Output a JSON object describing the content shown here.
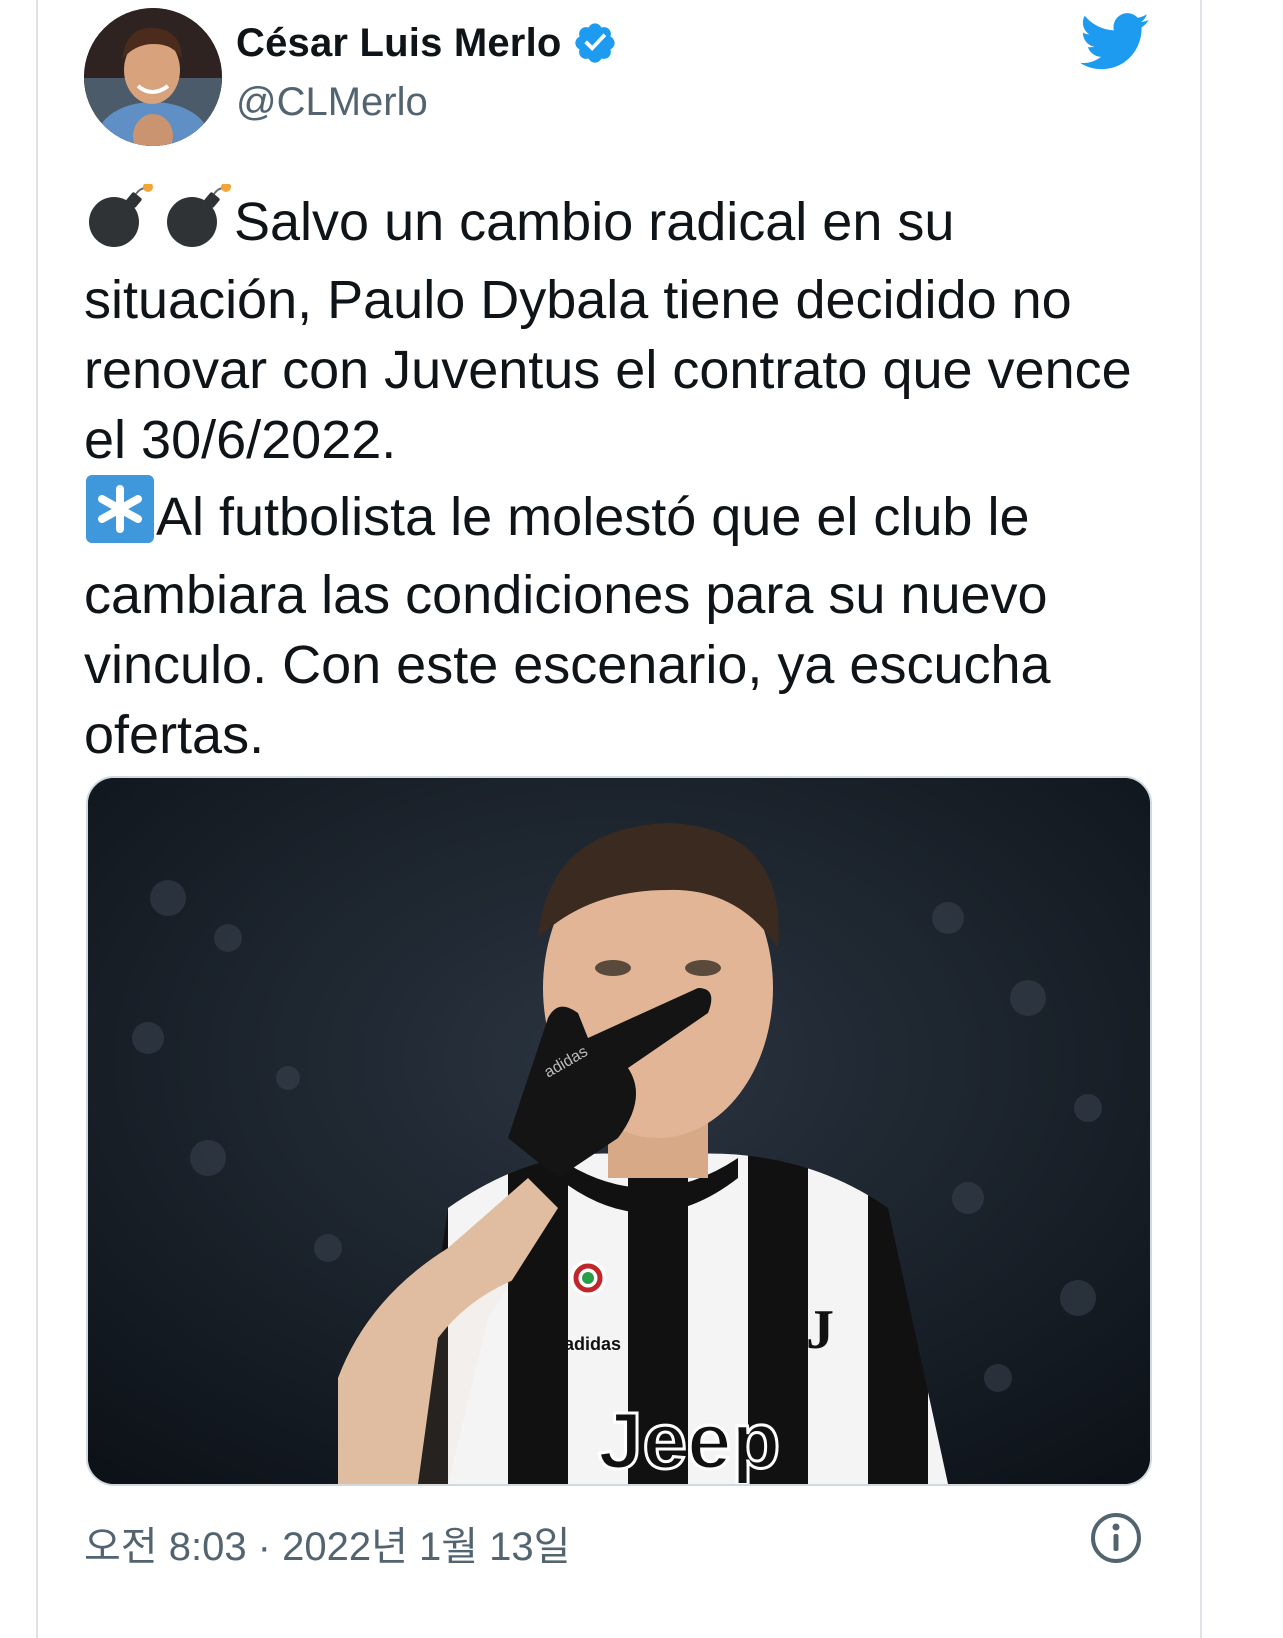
{
  "author": {
    "name": "César Luis Merlo",
    "handle": "@CLMerlo",
    "verified": true
  },
  "icons": {
    "verified": "verified-badge-icon",
    "brand": "twitter-bird-icon",
    "info": "info-icon"
  },
  "colors": {
    "brand": "#1d9bf0",
    "text": "#0f1419",
    "muted": "#536471"
  },
  "tweet": {
    "line1_emoji": "💣💣",
    "line1": "Salvo un cambio radical en su situación, Paulo Dybala tiene decidido no renovar con Juventus el contrato que vence el 30/6/2022.",
    "line2_emoji": "✳️",
    "line2": "Al futbolista le molestó que el club le cambiara las condiciones para su nuevo vinculo. Con este escenario, ya escucha ofertas."
  },
  "media": {
    "alt": "Photo: footballer in black and white striped Juventus jersey covering mouth with black glove",
    "jersey_sponsor": "Jeep",
    "kit_brand": "adidas"
  },
  "meta": {
    "timestamp": "오전 8:03 · 2022년 1월 13일"
  }
}
